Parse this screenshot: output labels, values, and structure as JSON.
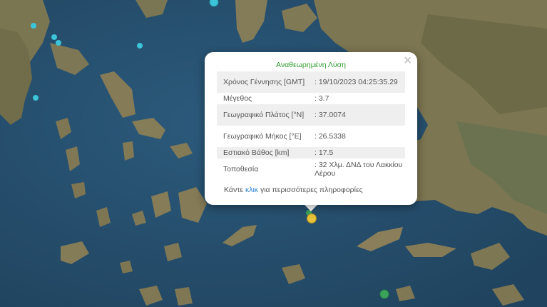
{
  "popup": {
    "title": "Αναθεωρημένη Λύση",
    "close_symbol": "×",
    "rows": [
      {
        "label": "Χρόνος Γέννησης [GMT]",
        "value": ": 19/10/2023 04:25:35.29"
      },
      {
        "label": "Μέγεθος",
        "value": ": 3.7"
      },
      {
        "label": "Γεωγραφικό Πλάτος [°N]",
        "value": ": 37.0074"
      },
      {
        "label": "Γεωγραφικό Μήκος [°E]",
        "value": ": 26.5338"
      },
      {
        "label": "Εστιακό Βάθος [km]",
        "value": ": 17.5"
      },
      {
        "label": "Τοποθεσία",
        "value": ": 32 Χλμ. ΔΝΔ του Λακκίου Λέρου"
      }
    ],
    "footer": {
      "before": "Κάντε ",
      "link": "κλικ",
      "after": " για περισσότερες πληροφορίες"
    }
  },
  "colors": {
    "sea": "#2a5575",
    "land": "#7f7a55",
    "quake_selected": "#e6c23a",
    "quake_other": "#3cc4d8",
    "quake_green": "#3aa55a",
    "title_green": "#2f9a2f",
    "link_blue": "#2a7fd0"
  }
}
